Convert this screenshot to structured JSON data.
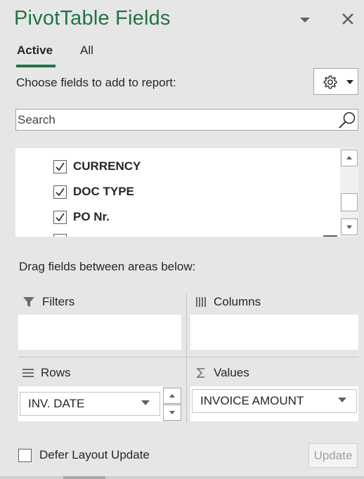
{
  "panel": {
    "title": "PivotTable Fields",
    "tabs": [
      {
        "label": "Active",
        "selected": true
      },
      {
        "label": "All",
        "selected": false
      }
    ],
    "choose_label": "Choose fields to add to report:",
    "settings_icon": "gear-icon",
    "close_icon": "close-icon"
  },
  "search": {
    "placeholder": "Search",
    "value": ""
  },
  "fields": [
    {
      "label": "CURRENCY",
      "checked": true
    },
    {
      "label": "DOC TYPE",
      "checked": true
    },
    {
      "label": "PO Nr.",
      "checked": true
    }
  ],
  "areas": {
    "drag_label": "Drag fields between areas below:",
    "filters": {
      "label": "Filters",
      "icon": "filter-icon"
    },
    "columns": {
      "label": "Columns",
      "icon": "columns-icon"
    },
    "rows": {
      "label": "Rows",
      "icon": "rows-icon",
      "items": [
        "INV. DATE"
      ]
    },
    "values": {
      "label": "Values",
      "icon": "sigma-icon",
      "items": [
        "INVOICE AMOUNT"
      ]
    }
  },
  "footer": {
    "defer_label": "Defer Layout Update",
    "defer_checked": false,
    "update_label": "Update"
  },
  "colors": {
    "accent": "#217346",
    "panel_bg": "#e6e6e6"
  }
}
